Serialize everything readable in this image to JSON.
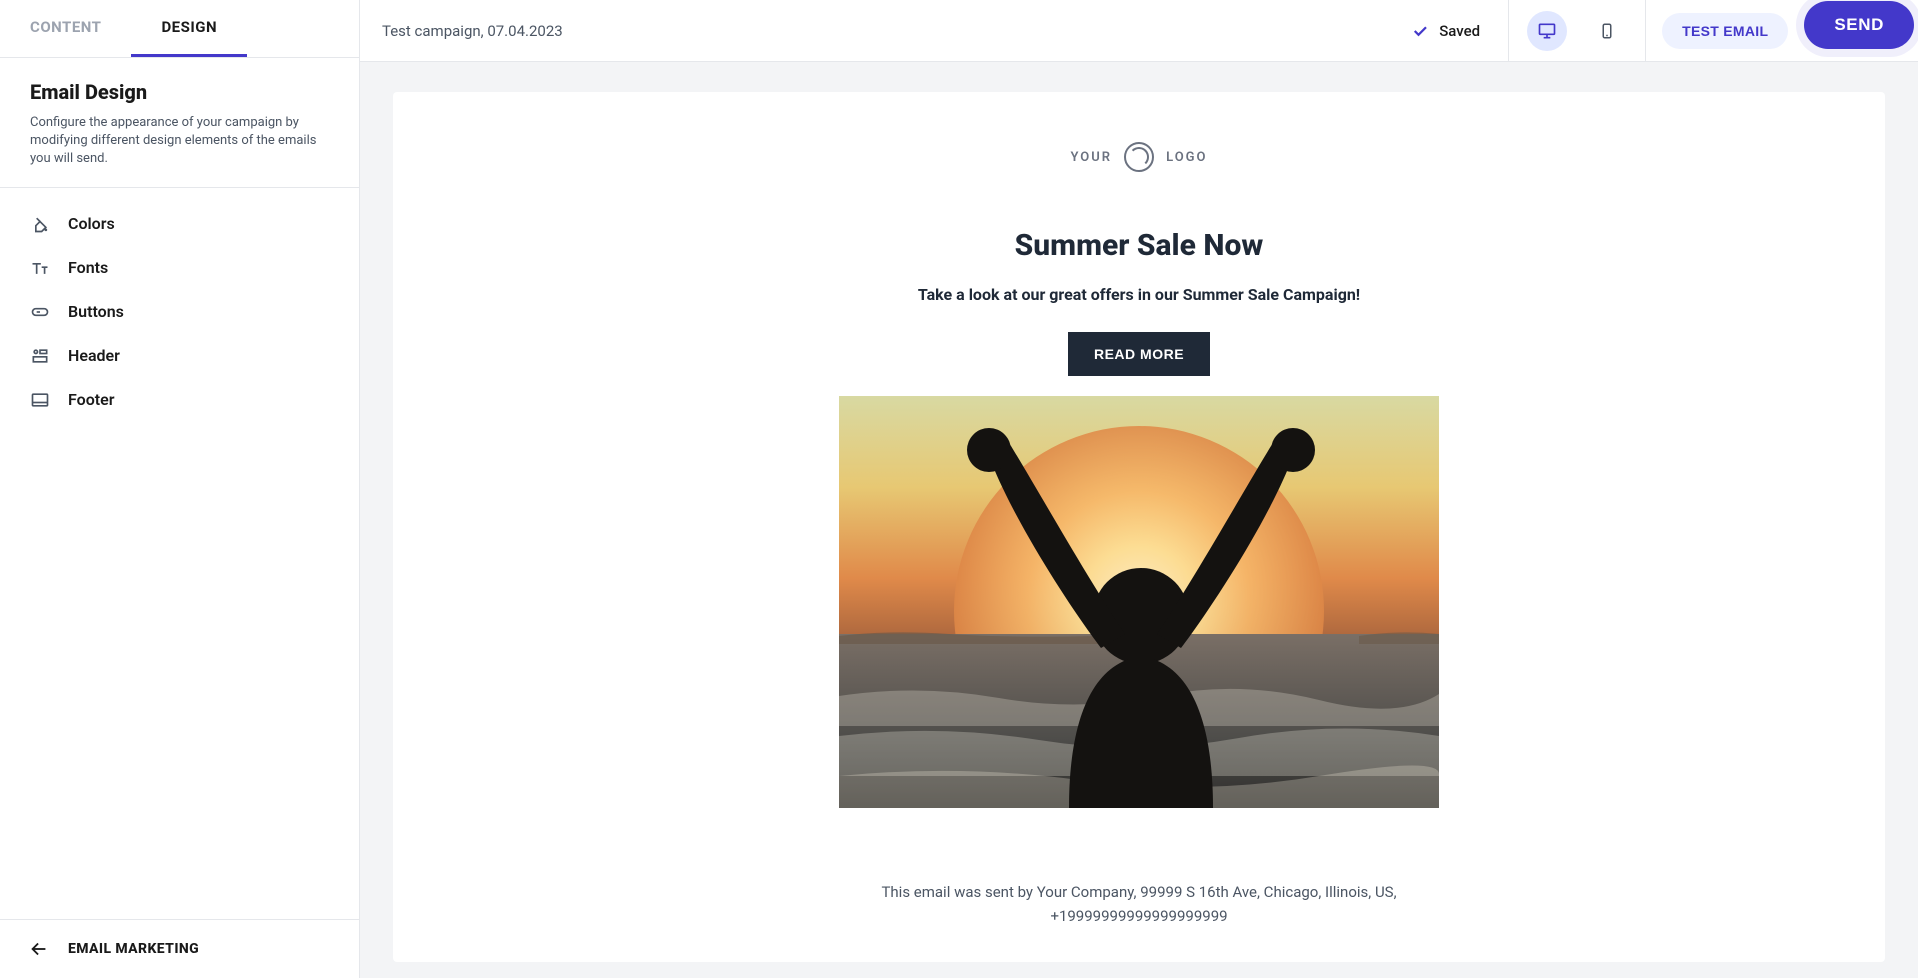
{
  "tabs": {
    "content": "CONTENT",
    "design": "DESIGN"
  },
  "section": {
    "title": "Email Design",
    "desc": "Configure the appearance of your campaign by modifying different design elements of the emails you will send."
  },
  "menu": {
    "colors": "Colors",
    "fonts": "Fonts",
    "buttons": "Buttons",
    "header": "Header",
    "footer": "Footer"
  },
  "sidebar_footer": "EMAIL MARKETING",
  "topbar": {
    "campaign": "Test campaign, 07.04.2023",
    "saved": "Saved",
    "test_email": "TEST EMAIL",
    "send": "SEND"
  },
  "email": {
    "logo_left": "YOUR",
    "logo_right": "LOGO",
    "headline": "Summer Sale Now",
    "subhead": "Take a look at our great offers in our Summer Sale Campaign!",
    "cta": "READ MORE",
    "footer": "This email was sent by Your Company, 99999 S 16th Ave, Chicago, Illinois, US, +19999999999999999999"
  }
}
